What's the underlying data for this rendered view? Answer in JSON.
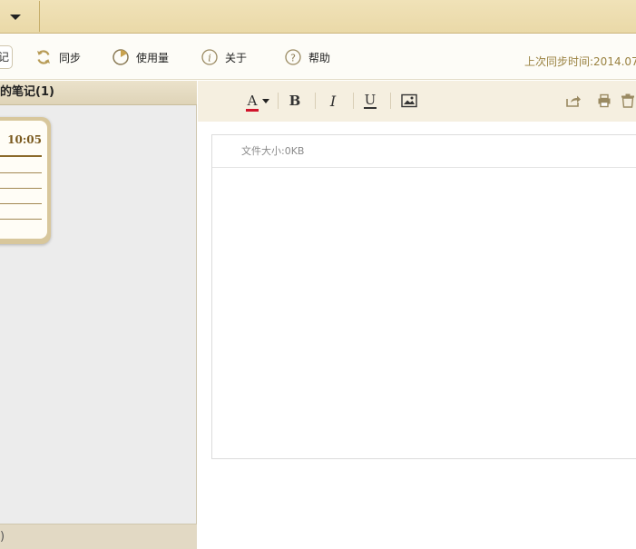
{
  "titlebar": {
    "menu_icon": "caret-down-icon"
  },
  "toolbar": {
    "partial_label": "记",
    "items": [
      {
        "label": "同步",
        "icon": "sync-icon"
      },
      {
        "label": "使用量",
        "icon": "pie-usage-icon"
      },
      {
        "label": "关于",
        "icon": "info-icon"
      },
      {
        "label": "帮助",
        "icon": "help-icon"
      }
    ],
    "last_sync": "上次同步时间:2014.07."
  },
  "left_panel": {
    "header": "的笔记(1)",
    "note": {
      "time": "10:05"
    },
    "footer": ")"
  },
  "editor": {
    "format_buttons": [
      {
        "label": "A",
        "icon": "font-color-icon"
      },
      {
        "label": "B",
        "icon": "bold-icon"
      },
      {
        "label": "I",
        "icon": "italic-icon"
      },
      {
        "label": "U",
        "icon": "underline-icon"
      },
      {
        "label": "",
        "icon": "image-icon"
      }
    ],
    "actions": [
      "share-icon",
      "print-icon",
      "delete-icon"
    ],
    "file_size": "文件大小:0KB",
    "body": ""
  },
  "colors": {
    "accent_gold": "#9a8241",
    "titlebar_bg": "#ebdaa9",
    "font_color_bar": "#d0142b"
  }
}
